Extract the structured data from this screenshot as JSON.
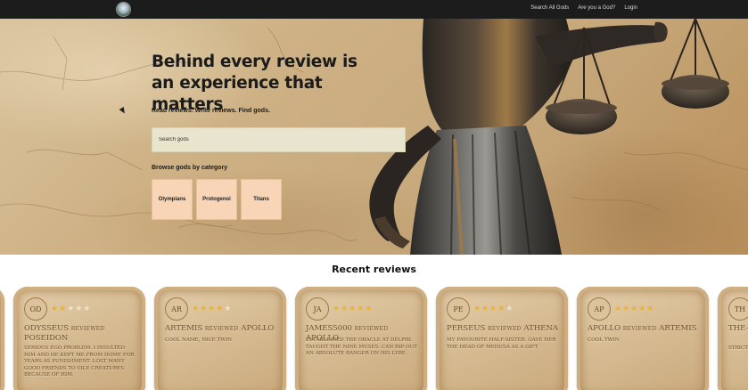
{
  "nav": {
    "links": [
      "Search All Gods",
      "Are you a God?",
      "Login"
    ]
  },
  "hero": {
    "title": "Behind every review is an experience that matters",
    "subtitle": "Read reviews. Write reviews. Find gods.",
    "search_placeholder": "Search gods",
    "browse_label": "Browse gods by category",
    "categories": [
      "Olympians",
      "Protogenoi",
      "Titans"
    ]
  },
  "recent": {
    "title": "Recent reviews",
    "reviews": [
      {
        "initials": "OD",
        "rating": 2,
        "reviewer": "ODYSSEUS",
        "verb": "REVIEWED",
        "god": "POSEIDON",
        "text": "SERIOUS EGO PROBLEM. I INSULTED HIM AND HE KEPT ME FROM HOME FOR YEARS AS PUNISHMENT. LOST MANY GOOD FRIENDS TO VILE CREATURES BECAUSE OF HIM."
      },
      {
        "initials": "AR",
        "rating": 4,
        "reviewer": "ARTEMIS",
        "verb": "REVIEWED",
        "god": "APOLLO",
        "text": "COOL NAME, NICE TWIN"
      },
      {
        "initials": "JA",
        "rating": 5,
        "reviewer": "JAMES5000",
        "verb": "REVIEWED",
        "god": "APOLLO",
        "text": "ESTABLISHED THE ORACLE AT DELPHI. TAUGHT THE NINE MUSES. CAN RIP OUT AN ABSOLUTE BANGER ON HIS LYRE."
      },
      {
        "initials": "PE",
        "rating": 4,
        "reviewer": "PERSEUS",
        "verb": "REVIEWED",
        "god": "ATHENA",
        "text": "MY FAVOURITE HALF-SISTER. GAVE HER THE HEAD OF MEDUSA AS A GIFT"
      },
      {
        "initials": "AP",
        "rating": 5,
        "reviewer": "APOLLO",
        "verb": "REVIEWED",
        "god": "ARTEMIS",
        "text": "COOL TWIN"
      },
      {
        "initials": "TH",
        "rating": 0,
        "reviewer": "THE-N",
        "verb": "",
        "god": "ARTE",
        "text": "STRICT CHOSE"
      }
    ]
  },
  "colors": {
    "nav_bg": "#1c1c1c",
    "search_bg": "#e8e4cd",
    "category_bg": "#f7d5b6",
    "star_on": "#f0b323",
    "card_text": "#6b4d2a"
  }
}
